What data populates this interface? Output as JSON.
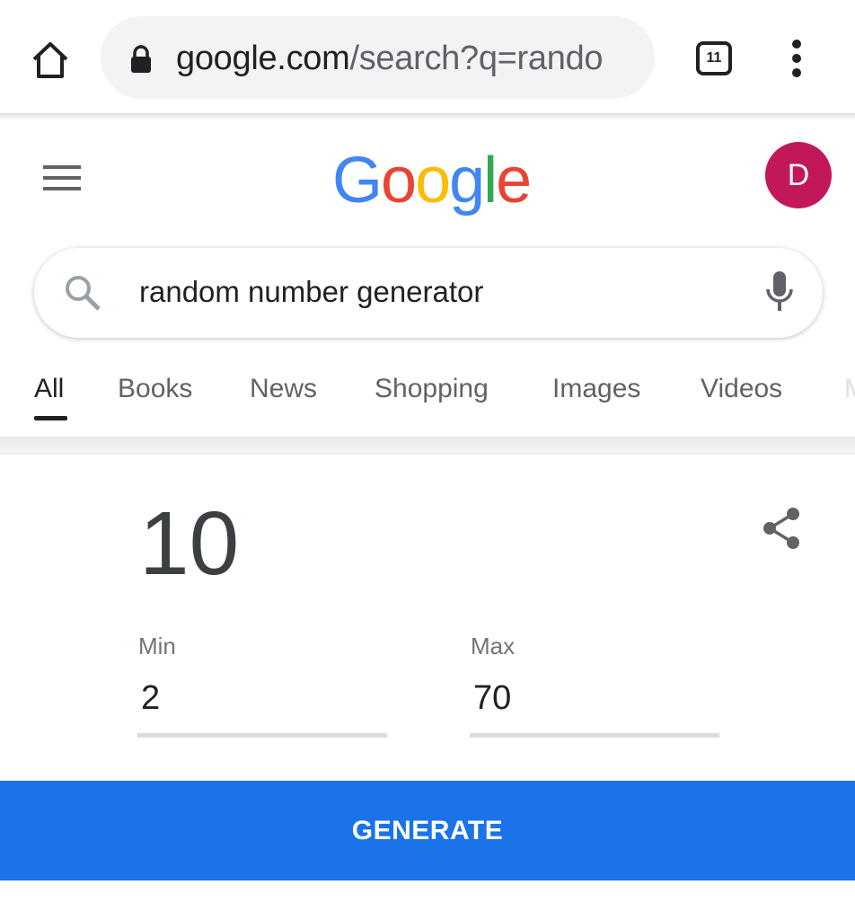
{
  "browser": {
    "url_host": "google.com",
    "url_path": "/search?q=rando",
    "tab_count": "11"
  },
  "header": {
    "logo": "Google",
    "avatar_letter": "D",
    "logo_colors": [
      "#4285f4",
      "#ea4335",
      "#fbbc05",
      "#4285f4",
      "#34a853",
      "#ea4335"
    ]
  },
  "search": {
    "query": "random number generator"
  },
  "tabs": [
    {
      "label": "All",
      "active": true
    },
    {
      "label": "Books"
    },
    {
      "label": "News"
    },
    {
      "label": "Shopping"
    },
    {
      "label": "Images"
    },
    {
      "label": "Videos"
    },
    {
      "label": "M"
    }
  ],
  "rng": {
    "result": "10",
    "min_label": "Min",
    "min_value": "2",
    "max_label": "Max",
    "max_value": "70",
    "generate_label": "GENERATE"
  },
  "colors": {
    "accent": "#1a73e8",
    "avatar": "#c2185b"
  }
}
